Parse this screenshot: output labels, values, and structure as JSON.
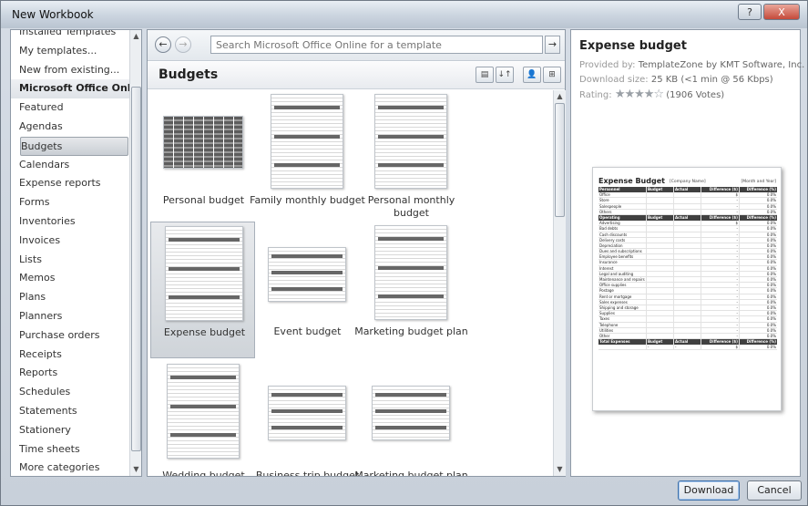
{
  "window": {
    "title": "New Workbook"
  },
  "title_controls": {
    "help": "?",
    "close": "X"
  },
  "categories": [
    {
      "label": "Installed Templates",
      "type": "item"
    },
    {
      "label": "My templates...",
      "type": "item"
    },
    {
      "label": "New from existing...",
      "type": "item"
    },
    {
      "label": "Microsoft Office Online",
      "type": "header"
    },
    {
      "label": "Featured",
      "type": "item"
    },
    {
      "label": "Agendas",
      "type": "item"
    },
    {
      "label": "Budgets",
      "type": "selected"
    },
    {
      "label": "Calendars",
      "type": "item"
    },
    {
      "label": "Expense reports",
      "type": "item"
    },
    {
      "label": "Forms",
      "type": "item"
    },
    {
      "label": "Inventories",
      "type": "item"
    },
    {
      "label": "Invoices",
      "type": "item"
    },
    {
      "label": "Lists",
      "type": "item"
    },
    {
      "label": "Memos",
      "type": "item"
    },
    {
      "label": "Plans",
      "type": "item"
    },
    {
      "label": "Planners",
      "type": "item"
    },
    {
      "label": "Purchase orders",
      "type": "item"
    },
    {
      "label": "Receipts",
      "type": "item"
    },
    {
      "label": "Reports",
      "type": "item"
    },
    {
      "label": "Schedules",
      "type": "item"
    },
    {
      "label": "Statements",
      "type": "item"
    },
    {
      "label": "Stationery",
      "type": "item"
    },
    {
      "label": "Time sheets",
      "type": "item"
    },
    {
      "label": "More categories",
      "type": "item"
    }
  ],
  "search": {
    "placeholder": "Search Microsoft Office Online for a template",
    "go": "→"
  },
  "nav": {
    "back": "←",
    "forward": "→"
  },
  "section": {
    "title": "Budgets"
  },
  "view_buttons": [
    "▤",
    "↓↑",
    "👤",
    "⊞"
  ],
  "templates": [
    {
      "label": "Personal budget",
      "style": "dark"
    },
    {
      "label": "Family monthly budget",
      "style": "portrait"
    },
    {
      "label": "Personal monthly budget",
      "style": "portrait"
    },
    {
      "label": "Expense budget",
      "style": "portrait",
      "selected": true
    },
    {
      "label": "Event budget",
      "style": "landscape"
    },
    {
      "label": "Marketing budget plan",
      "style": "portrait"
    },
    {
      "label": "Wedding budget",
      "style": "portrait"
    },
    {
      "label": "Business trip budget",
      "style": "landscape"
    },
    {
      "label": "Marketing budget plan",
      "style": "landscape"
    }
  ],
  "preview": {
    "title": "Expense budget",
    "provided_label": "Provided by:",
    "provided_value": "TemplateZone by KMT Software, Inc.",
    "size_label": "Download size:",
    "size_value": "25 KB (<1 min @ 56 Kbps)",
    "rating_label": "Rating:",
    "rating": 4,
    "rating_max": 5,
    "votes": "(1906 Votes)",
    "doc": {
      "title": "Expense Budget",
      "company": "[Company Name]",
      "period": "[Month and Year]",
      "sections": [
        {
          "header": [
            "Personnel",
            "Budget",
            "Actual",
            "Difference ($)",
            "Difference (%)"
          ],
          "rows": [
            "Office",
            "Store",
            "Salespeople",
            "Others"
          ]
        },
        {
          "header": [
            "Operating",
            "Budget",
            "Actual",
            "Difference ($)",
            "Difference (%)"
          ],
          "rows": [
            "Advertising",
            "Bad debts",
            "Cash discounts",
            "Delivery costs",
            "Depreciation",
            "Dues and subscriptions",
            "Employee benefits",
            "Insurance",
            "Interest",
            "Legal and auditing",
            "Maintenance and repairs",
            "Office supplies",
            "Postage",
            "Rent or mortgage",
            "Sales expenses",
            "Shipping and storage",
            "Supplies",
            "Taxes",
            "Telephone",
            "Utilities",
            "Other"
          ]
        },
        {
          "header": [
            "Total Expenses",
            "Budget",
            "Actual",
            "Difference ($)",
            "Difference (%)"
          ],
          "rows": [
            ""
          ]
        }
      ],
      "cell_dollar": "$",
      "cell_dash": "-",
      "cell_pct": "0.0%"
    }
  },
  "buttons": {
    "download": "Download",
    "cancel": "Cancel"
  }
}
